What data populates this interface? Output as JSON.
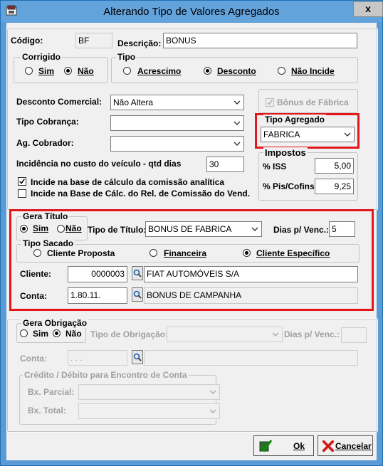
{
  "window": {
    "title": "Alterando Tipo de Valores Agregados",
    "close_label": "x"
  },
  "header": {
    "codigo_label": "Código:",
    "codigo_value": "BF",
    "descricao_label": "Descrição:",
    "descricao_value": "BONUS"
  },
  "corrigido": {
    "title": "Corrigido",
    "options": [
      "Sim",
      "Não"
    ],
    "selected": "Não"
  },
  "tipo": {
    "title": "Tipo",
    "options": [
      "Acrescimo",
      "Desconto",
      "Não Incide"
    ],
    "selected": "Desconto"
  },
  "desconto_comercial": {
    "label": "Desconto Comercial:",
    "value": "Não Altera"
  },
  "tipo_cobranca": {
    "label": "Tipo Cobrança:",
    "value": ""
  },
  "ag_cobrador": {
    "label": "Ag. Cobrador:",
    "value": ""
  },
  "bonus_fabrica": {
    "label": "Bônus de Fábrica",
    "checked": true
  },
  "tipo_agregado": {
    "title": "Tipo Agregado",
    "value": "FABRICA"
  },
  "incidencia": {
    "label": "Incidência no custo do veículo - qtd dias",
    "value": "30"
  },
  "checks": {
    "comissao": {
      "label": "Incide na base de cálculo da comissão analítica",
      "checked": true
    },
    "rel_comissao": {
      "label": "Incide na Base de Cálc. do Rel. de Comissão do Vend.",
      "checked": false
    }
  },
  "impostos": {
    "title": "Impostos",
    "iss_label": "% ISS",
    "iss_value": "5,00",
    "pis_label": "% Pis/Cofins",
    "pis_value": "9,25"
  },
  "gera_titulo": {
    "title": "Gera Título",
    "options": [
      "Sim",
      "Não"
    ],
    "selected": "Sim",
    "tipo_titulo_label": "Tipo de Título:",
    "tipo_titulo_value": "BONUS DE FABRICA",
    "dias_label": "Dias p/ Venc.:",
    "dias_value": "5"
  },
  "tipo_sacado": {
    "title": "Tipo Sacado",
    "options": [
      "Cliente Proposta",
      "Financeira",
      "Cliente Específico"
    ],
    "selected": "Cliente Específico"
  },
  "cliente": {
    "label": "Cliente:",
    "code": "0000003",
    "name": "FIAT AUTOMÓVEIS S/A"
  },
  "conta": {
    "label": "Conta:",
    "code": "1.80.11.",
    "name": "BONUS DE CAMPANHA"
  },
  "gera_obrigacao": {
    "title": "Gera Obrigação",
    "options": [
      "Sim",
      "Não"
    ],
    "selected": "Não",
    "tipo_label": "Tipo de Obrigação:",
    "dias_label": "Dias p/ Venc.:",
    "conta_label": "Conta:",
    "conta_code": ". . .",
    "credito_title": "Crédito / Débito para Encontro de Conta",
    "bx_parcial_label": "Bx. Parcial:",
    "bx_total_label": "Bx. Total:"
  },
  "buttons": {
    "ok": "Ok",
    "cancel": "Cancelar"
  },
  "colors": {
    "highlight": "#e3161c",
    "titlebar": "#63a3dc",
    "client_bg": "#f0f0f0"
  }
}
